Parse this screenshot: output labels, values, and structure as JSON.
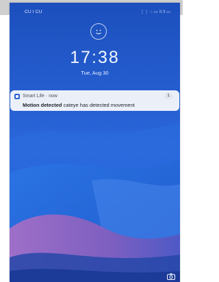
{
  "status_bar": {
    "carrier": "CU I CU",
    "icons_text": "⋮⋮ ◌ ▭ ⁞l ⁞l ▭"
  },
  "lock_screen": {
    "time": "17:38",
    "date": "Tue, Aug 30"
  },
  "notification": {
    "app_name": "Smart Life · now",
    "count": "1",
    "title": "Motion detected",
    "body": "cateye has detected movement"
  },
  "icons": {
    "face_unlock": "face-unlock-icon",
    "camera": "camera-icon",
    "app": "smart-life-app-icon"
  },
  "colors": {
    "wallpaper_blue": "#1f56c6",
    "wave_purple": "#7b5ab7"
  }
}
